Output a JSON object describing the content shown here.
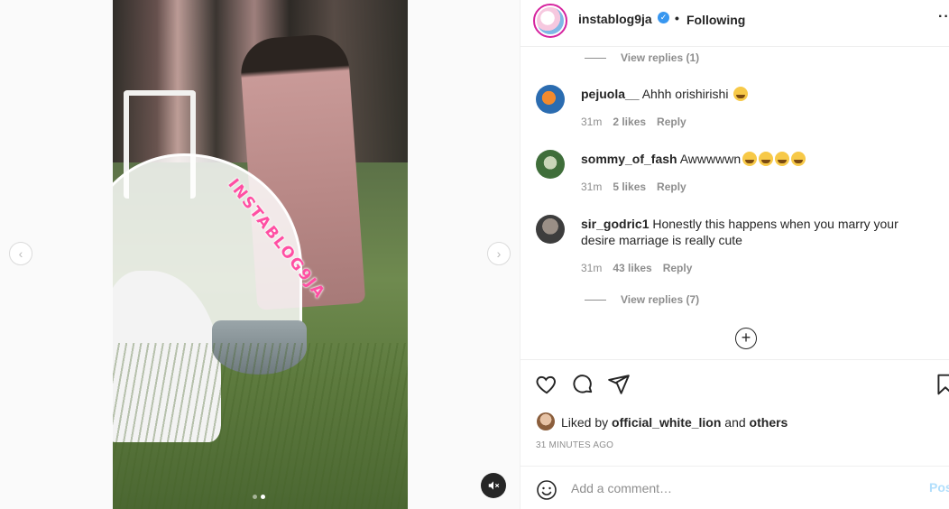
{
  "post": {
    "watermark": "INSTABLOG9JA",
    "slide_count": 2,
    "active_slide": 2
  },
  "header": {
    "username": "instablog9ja",
    "verified_glyph": "✓",
    "separator": "•",
    "follow_status": "Following",
    "more_glyph": "·· "
  },
  "nav": {
    "prev_glyph": "‹",
    "next_glyph": "›"
  },
  "comments": [
    {
      "username": "pejuola__",
      "text": "Ahhh orishirishi",
      "emoji_count": 1,
      "time": "31m",
      "likes": "2 likes",
      "reply": "Reply",
      "avatar_color": "#2b6cb0"
    },
    {
      "username": "sommy_of_fash",
      "text": "Awwwwwn",
      "emoji_count": 4,
      "time": "31m",
      "likes": "5 likes",
      "reply": "Reply",
      "avatar_color": "#3f6e3a"
    },
    {
      "username": "sir_godric1",
      "text": "Honestly this happens when you marry your desire marriage is really cute",
      "emoji_count": 0,
      "time": "31m",
      "likes": "43 likes",
      "reply": "Reply",
      "avatar_color": "#4a4a4a"
    }
  ],
  "view_replies_top": "View replies (1)",
  "view_replies_bottom": "View replies (7)",
  "load_more_glyph": "+",
  "likes": {
    "prefix": "Liked by",
    "user": "official_white_lion",
    "conjunction": "and",
    "others": "others"
  },
  "timestamp": "31 MINUTES AGO",
  "comment_box": {
    "placeholder": "Add a comment…",
    "post_label": "Pos"
  },
  "colors": {
    "verified": "#3897f0",
    "post_button": "#b2dffc",
    "secondary_text": "#8e8e8e"
  },
  "icons": [
    "heart-icon",
    "comment-icon",
    "share-icon",
    "bookmark-icon",
    "emoji-icon",
    "mute-icon",
    "add-circle-icon",
    "verified-icon"
  ]
}
